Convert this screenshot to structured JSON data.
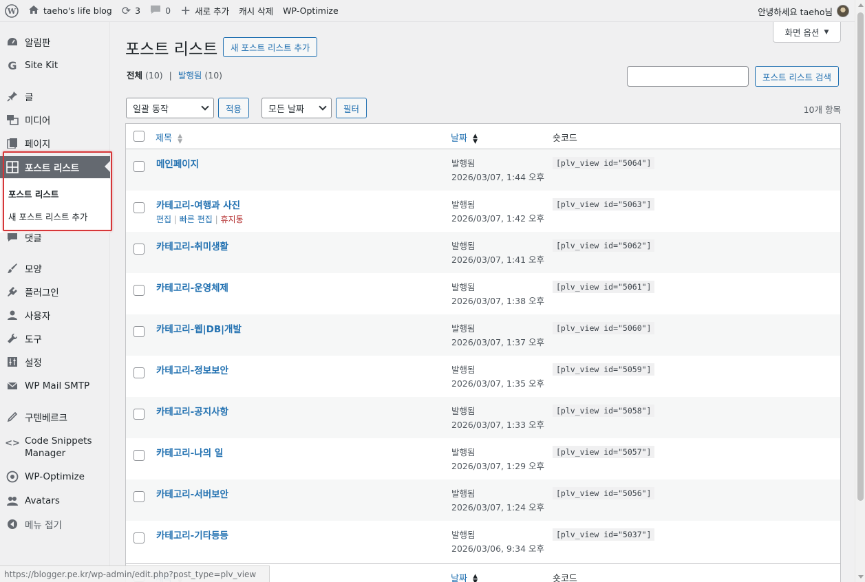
{
  "adminbar": {
    "site_name": "taeho's life blog",
    "updates_count": "3",
    "comments_count": "0",
    "new_label": "새로 추가",
    "cache_label": "캐시 삭제",
    "wpo_label": "WP-Optimize",
    "greeting": "안녕하세요 taeho님"
  },
  "sidebar": {
    "items": [
      {
        "label": "알림판",
        "icon": "dashboard-icon"
      },
      {
        "label": "Site Kit",
        "icon": "google-g-icon"
      },
      {
        "label": "글",
        "icon": "pin-icon"
      },
      {
        "label": "미디어",
        "icon": "media-icon"
      },
      {
        "label": "페이지",
        "icon": "page-icon"
      },
      {
        "label": "포스트 리스트",
        "icon": "grid-icon"
      },
      {
        "label": "댓글",
        "icon": "comment-icon"
      },
      {
        "label": "모양",
        "icon": "brush-icon"
      },
      {
        "label": "플러그인",
        "icon": "plugin-icon"
      },
      {
        "label": "사용자",
        "icon": "user-icon"
      },
      {
        "label": "도구",
        "icon": "wrench-icon"
      },
      {
        "label": "설정",
        "icon": "settings-icon"
      },
      {
        "label": "WP Mail SMTP",
        "icon": "mail-icon"
      },
      {
        "label": "구텐베르크",
        "icon": "pencil-icon"
      },
      {
        "label": "Code Snippets Manager",
        "icon": "code-icon"
      },
      {
        "label": "WP-Optimize",
        "icon": "wpo-icon"
      },
      {
        "label": "Avatars",
        "icon": "avatars-icon"
      },
      {
        "label": "메뉴 접기",
        "icon": "collapse-icon"
      }
    ],
    "submenu": [
      "포스트 리스트",
      "새 포스트 리스트 추가"
    ]
  },
  "main": {
    "title": "포스트 리스트",
    "add_new": "새 포스트 리스트 추가",
    "screen_options": "화면 옵션",
    "filters": {
      "all": "전체",
      "all_count": "(10)",
      "published": "발행됨",
      "published_count": "(10)",
      "sep": "|"
    },
    "search_button": "포스트 리스트 검색",
    "bulk_action": "일괄 동작",
    "apply": "적용",
    "all_dates": "모든 날짜",
    "filter": "필터",
    "items_count": "10개 항목",
    "columns": {
      "title": "제목",
      "date": "날짜",
      "shortcode": "숏코드"
    },
    "row_actions": {
      "edit": "편집",
      "quick_edit": "빠른 편집",
      "trash": "휴지통",
      "sep": "|"
    },
    "rows": [
      {
        "title": "메인페이지",
        "status": "발행됨",
        "date": "2026/03/07, 1:44 오후",
        "code": "[plv_view id=\"5064\"]"
      },
      {
        "title": "카테고리-여행과 사진",
        "status": "발행됨",
        "date": "2026/03/07, 1:42 오후",
        "code": "[plv_view id=\"5063\"]"
      },
      {
        "title": "카테고리-취미생활",
        "status": "발행됨",
        "date": "2026/03/07, 1:41 오후",
        "code": "[plv_view id=\"5062\"]"
      },
      {
        "title": "카테고리-운영체제",
        "status": "발행됨",
        "date": "2026/03/07, 1:38 오후",
        "code": "[plv_view id=\"5061\"]"
      },
      {
        "title": "카테고리-웹|DB|개발",
        "status": "발행됨",
        "date": "2026/03/07, 1:37 오후",
        "code": "[plv_view id=\"5060\"]"
      },
      {
        "title": "카테고리-정보보안",
        "status": "발행됨",
        "date": "2026/03/07, 1:35 오후",
        "code": "[plv_view id=\"5059\"]"
      },
      {
        "title": "카테고리-공지사항",
        "status": "발행됨",
        "date": "2026/03/07, 1:33 오후",
        "code": "[plv_view id=\"5058\"]"
      },
      {
        "title": "카테고리-나의 일",
        "status": "발행됨",
        "date": "2026/03/07, 1:29 오후",
        "code": "[plv_view id=\"5057\"]"
      },
      {
        "title": "카테고리-서버보안",
        "status": "발행됨",
        "date": "2026/03/07, 1:24 오후",
        "code": "[plv_view id=\"5056\"]"
      },
      {
        "title": "카테고리-기타등등",
        "status": "발행됨",
        "date": "2026/03/06, 9:34 오후",
        "code": "[plv_view id=\"5037\"]"
      }
    ]
  },
  "statusbar": {
    "url": "https://blogger.pe.kr/wp-admin/edit.php?post_type=plv_view"
  },
  "colors": {
    "accent": "#2271b1",
    "active_menu": "#646970",
    "highlight": "#d63638",
    "trash": "#b32d2e"
  }
}
